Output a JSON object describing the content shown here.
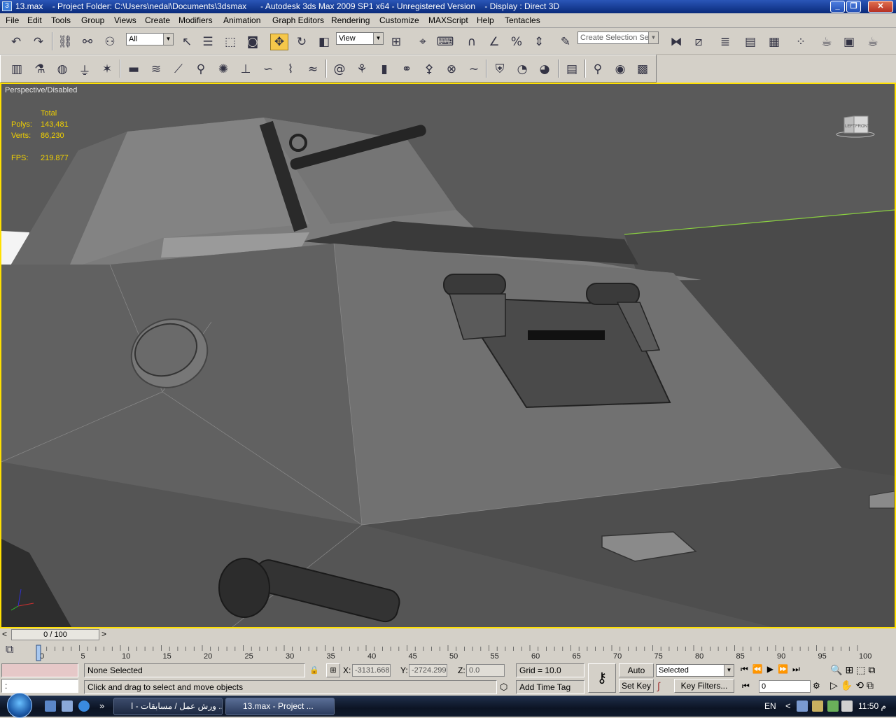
{
  "titlebar": {
    "file": "13.max",
    "project": "- Project Folder: C:\\Users\\nedal\\Documents\\3dsmax",
    "app": "- Autodesk 3ds Max  2009 SP1  x64  - Unregistered Version",
    "display": "- Display : Direct 3D",
    "min": "_",
    "max": "❐",
    "close": "✕"
  },
  "menu": [
    "File",
    "Edit",
    "Tools",
    "Group",
    "Views",
    "Create",
    "Modifiers",
    "Animation",
    "Graph Editors",
    "Rendering",
    "Customize",
    "MAXScript",
    "Help",
    "Tentacles"
  ],
  "toolbar": {
    "selection_filter": "All",
    "ref_coord": "View",
    "named_selection": "Create Selection Set",
    "icon_names": [
      "undo-icon",
      "redo-icon",
      "select-and-link-icon",
      "unlink-icon",
      "bind-to-space-warp-icon",
      "select-object-icon",
      "select-by-name-icon",
      "rectangular-selection-icon",
      "window-crossing-icon",
      "select-and-move-icon",
      "select-and-rotate-icon",
      "select-and-scale-icon",
      "use-pivot-center-icon",
      "select-and-manipulate-icon",
      "keyboard-shortcut-override-icon",
      "snaps-toggle-icon",
      "angle-snap-icon",
      "percent-snap-icon",
      "spinner-snap-icon",
      "edit-named-selection-icon",
      "mirror-icon",
      "align-icon",
      "layer-manager-icon",
      "curve-editor-icon",
      "schematic-view-icon",
      "material-editor-icon",
      "render-setup-icon",
      "rendered-frame-window-icon",
      "render-production-icon"
    ]
  },
  "toolbar2": {
    "icon_names": [
      "tool-a-icon",
      "tool-b-icon",
      "tool-c-icon",
      "tool-d-icon",
      "tool-e-icon",
      "tool-f-icon",
      "tool-g-icon",
      "tool-h-icon",
      "tool-i-icon",
      "tool-j-icon",
      "tool-k-icon",
      "tool-l-icon",
      "tool-m-icon",
      "tool-n-icon",
      "tool-o-icon",
      "tool-p-icon",
      "tool-q-icon",
      "tool-r-icon",
      "tool-s-icon",
      "tool-t-icon",
      "tool-u-icon",
      "tool-v-icon",
      "tool-w-icon",
      "tool-x-icon",
      "tool-y-icon",
      "tool-z-icon",
      "tool-aa-icon",
      "tool-ab-icon",
      "tool-ac-icon"
    ]
  },
  "viewport": {
    "label": "Perspective/Disabled",
    "stats_header": "Total",
    "polys_label": "Polys:",
    "polys_value": "143,481",
    "verts_label": "Verts:",
    "verts_value": "86,230",
    "fps_label": "FPS:",
    "fps_value": "219.877",
    "viewcube_left": "LEFT",
    "viewcube_front": "FRONT",
    "stats_color": "#f0d000",
    "active_border": "#ffe000"
  },
  "trackbar": {
    "frame": "0 / 100",
    "prev": "<",
    "next": ">"
  },
  "timeline": {
    "ticks": [
      "0",
      "5",
      "10",
      "15",
      "20",
      "25",
      "30",
      "35",
      "40",
      "45",
      "50",
      "55",
      "60",
      "65",
      "70",
      "75",
      "80",
      "85",
      "90",
      "95",
      "100"
    ]
  },
  "status": {
    "selection": "None Selected",
    "prompt": "Click and drag to select and move objects",
    "maxscript": ":",
    "x_label": "X:",
    "x_value": "-3131.668",
    "y_label": "Y:",
    "y_value": "-2724.299",
    "z_label": "Z:",
    "z_value": "0.0",
    "grid": "Grid = 10.0",
    "add_time_tag": "Add Time Tag",
    "auto_key": "Auto Key",
    "set_key": "Set Key",
    "key_mode": "Selected",
    "key_filters": "Key Filters...",
    "current_frame": "0"
  },
  "taskbar": {
    "task1": "ورش عمل / مسابقات - ا ...",
    "task2": "13.max     - Project ...",
    "lang": "EN",
    "time": "11:50 م",
    "chevron": "»",
    "tray_arrow": "<"
  }
}
